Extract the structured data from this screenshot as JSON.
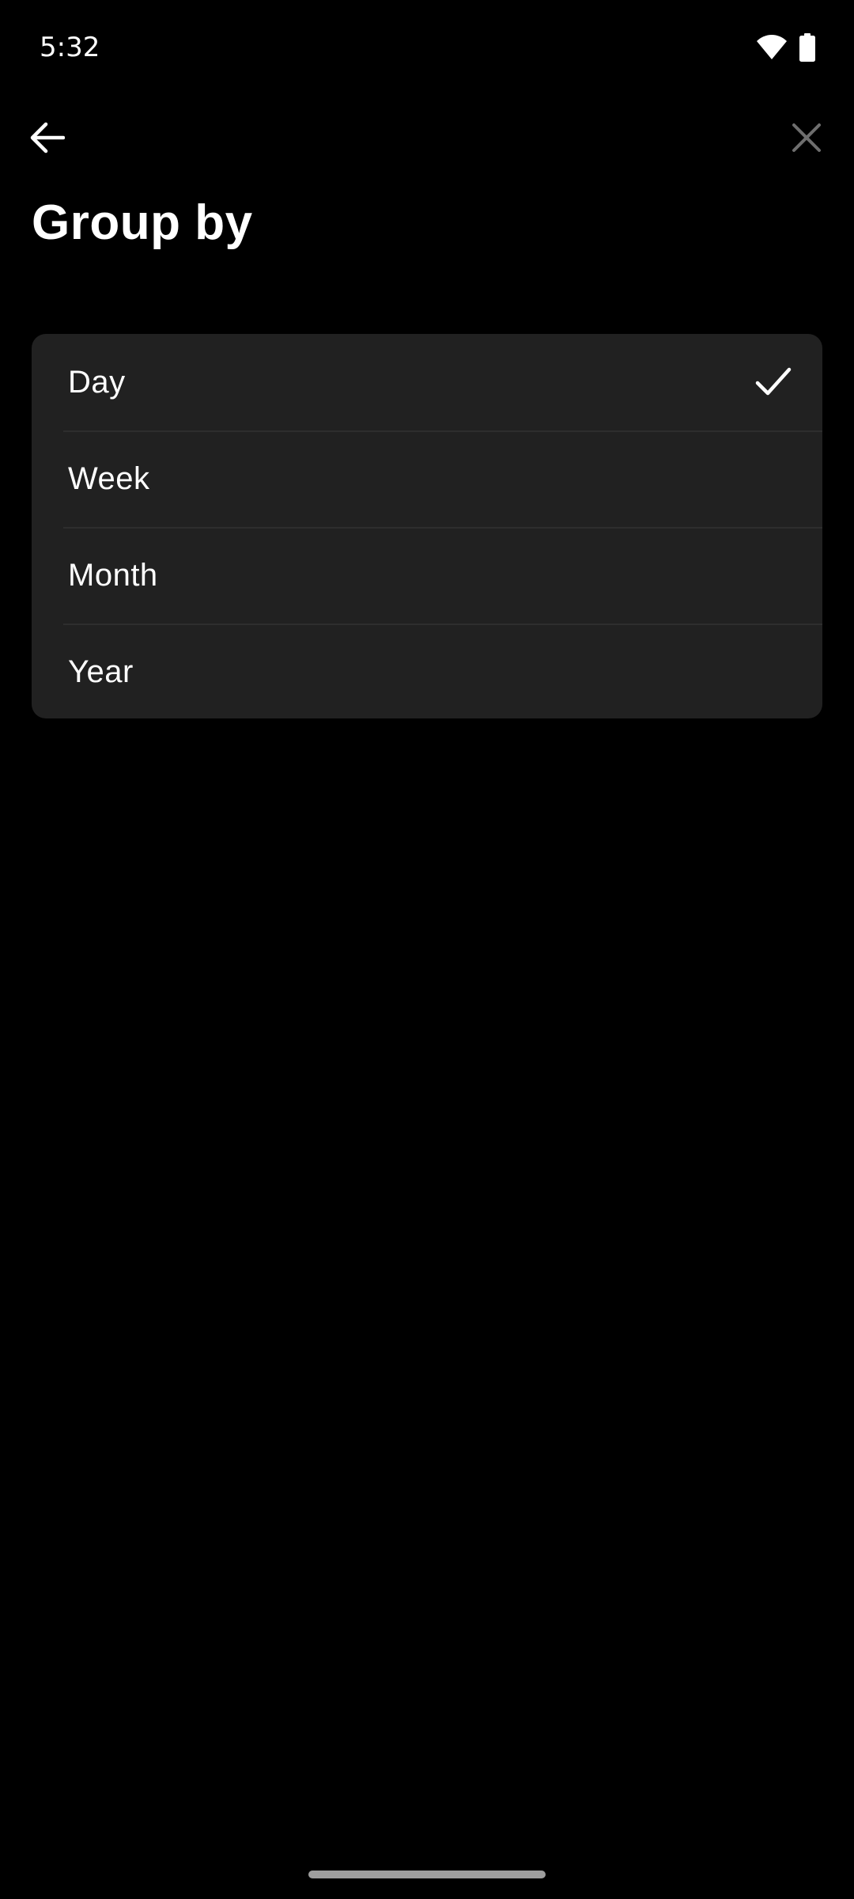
{
  "status_bar": {
    "time": "5:32",
    "wifi_icon": "wifi-icon",
    "battery_icon": "battery-icon"
  },
  "app_bar": {
    "back_icon": "arrow-back-icon",
    "close_icon": "close-icon"
  },
  "page": {
    "title": "Group by"
  },
  "options": {
    "items": [
      {
        "label": "Day",
        "selected": true
      },
      {
        "label": "Week",
        "selected": false
      },
      {
        "label": "Month",
        "selected": false
      },
      {
        "label": "Year",
        "selected": false
      }
    ],
    "check_icon": "check-icon"
  },
  "colors": {
    "background": "#000000",
    "card": "#212121",
    "divider": "#2e2e2e",
    "text": "#ffffff",
    "close_icon": "#6e6e6e",
    "home_indicator": "#9e9e9e"
  }
}
